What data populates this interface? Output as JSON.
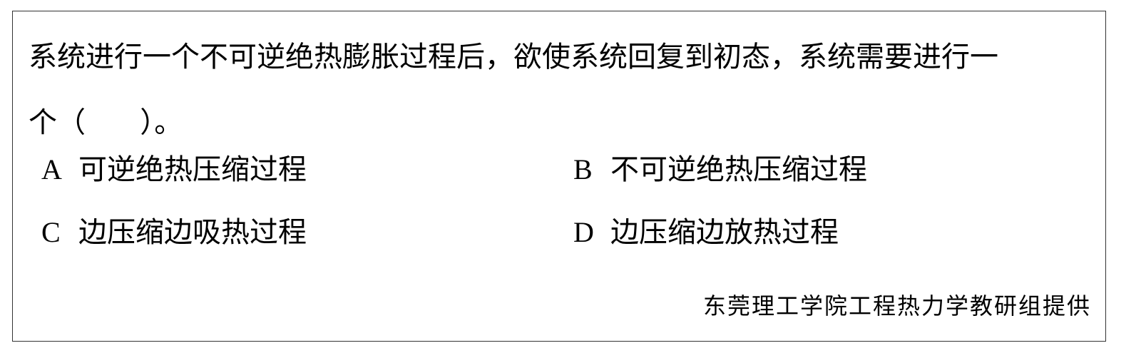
{
  "question": {
    "line1": "系统进行一个不可逆绝热膨胀过程后，欲使系统回复到初态，系统需要进行一",
    "line2": "个（      ）。"
  },
  "options": [
    {
      "letter": "A",
      "text": "可逆绝热压缩过程"
    },
    {
      "letter": "B",
      "text": "不可逆绝热压缩过程"
    },
    {
      "letter": "C",
      "text": "边压缩边吸热过程"
    },
    {
      "letter": "D",
      "text": "边压缩边放热过程"
    }
  ],
  "credit": "东莞理工学院工程热力学教研组提供"
}
